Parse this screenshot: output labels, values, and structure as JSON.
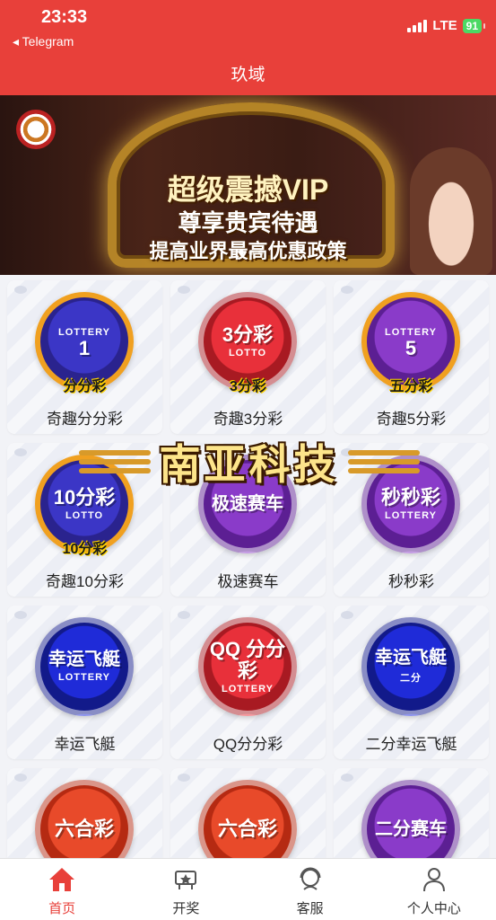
{
  "status_bar": {
    "time": "23:33",
    "back_app": "◂ Telegram",
    "network": "LTE",
    "battery": "91"
  },
  "header": {
    "title": "玖域"
  },
  "banner": {
    "line1": "超级震撼VIP",
    "line2": "尊享贵宾待遇",
    "line3": "提高业界最高优惠政策"
  },
  "watermark": {
    "text": "南亚科技"
  },
  "games": [
    {
      "label": "奇趣分分彩",
      "logo_text": "1",
      "logo_sub": "LOTTERY",
      "tag": "分分彩",
      "color": "blue"
    },
    {
      "label": "奇趣3分彩",
      "logo_text": "3分彩",
      "logo_sub": "LOTTO",
      "tag": "3分彩",
      "color": "red"
    },
    {
      "label": "奇趣5分彩",
      "logo_text": "5",
      "logo_sub": "LOTTERY",
      "tag": "五分彩",
      "color": "purple"
    },
    {
      "label": "奇趣10分彩",
      "logo_text": "10分彩",
      "logo_sub": "LOTTO",
      "tag": "10分彩",
      "color": "blue"
    },
    {
      "label": "极速赛车",
      "logo_text": "极速赛车",
      "logo_sub": "",
      "tag": "",
      "color": "purple"
    },
    {
      "label": "秒秒彩",
      "logo_text": "秒秒彩",
      "logo_sub": "LOTTERY",
      "tag": "",
      "color": "purple"
    },
    {
      "label": "幸运飞艇",
      "logo_text": "幸运飞艇",
      "logo_sub": "LOTTERY",
      "tag": "",
      "color": "navy"
    },
    {
      "label": "QQ分分彩",
      "logo_text": "QQ 分分彩",
      "logo_sub": "LOTTERY",
      "tag": "",
      "color": "red"
    },
    {
      "label": "二分幸运飞艇",
      "logo_text": "幸运飞艇",
      "logo_sub": "二分",
      "tag": "",
      "color": "navy"
    },
    {
      "label": "",
      "logo_text": "六合彩",
      "logo_sub": "",
      "tag": "",
      "color": "orange"
    },
    {
      "label": "",
      "logo_text": "六合彩",
      "logo_sub": "",
      "tag": "",
      "color": "orange"
    },
    {
      "label": "",
      "logo_text": "二分赛车",
      "logo_sub": "",
      "tag": "",
      "color": "purple"
    }
  ],
  "tabs": [
    {
      "label": "首页",
      "icon": "home-icon",
      "active": true
    },
    {
      "label": "开奖",
      "icon": "award-icon",
      "active": false
    },
    {
      "label": "客服",
      "icon": "service-icon",
      "active": false
    },
    {
      "label": "个人中心",
      "icon": "user-icon",
      "active": false
    }
  ],
  "colors": {
    "accent": "#e8403a",
    "background": "#f2f3f7"
  }
}
